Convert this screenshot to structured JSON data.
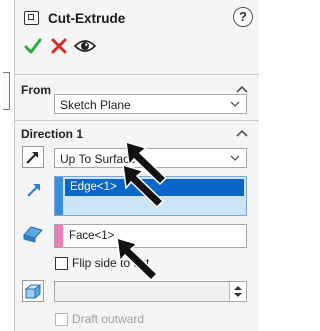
{
  "header": {
    "title": "Cut-Extrude",
    "help_label": "?"
  },
  "actions": {
    "ok": "ok",
    "cancel": "cancel",
    "preview": "preview"
  },
  "from_section": {
    "heading": "From",
    "selected": "Sketch Plane"
  },
  "direction1": {
    "heading": "Direction 1",
    "end_condition": "Up To Surface",
    "edge_selection": "Edge<1>",
    "face_selection": "Face<1>",
    "flip_label": "Flip side to cut",
    "flip_checked": false,
    "draft_label": "Draft outward",
    "draft_checked": false
  },
  "colors": {
    "accent_blue": "#0a67c9",
    "edge_stripe": "#3a8edc",
    "face_stripe": "#f07ab6",
    "ok_green": "#2eaa3c",
    "cancel_red": "#d42a2a"
  }
}
